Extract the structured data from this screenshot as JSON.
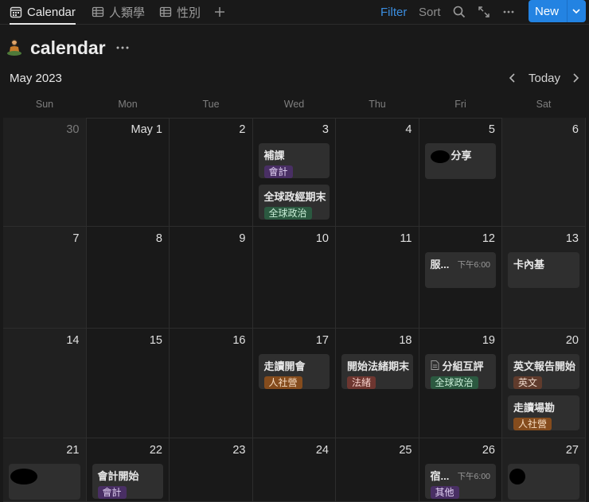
{
  "tabs": [
    {
      "label": "Calendar",
      "icon": "calendar-icon",
      "active": true
    },
    {
      "label": "人類學",
      "icon": "table-icon",
      "active": false
    },
    {
      "label": "性別",
      "icon": "table-icon",
      "active": false
    }
  ],
  "toolbar": {
    "filter_label": "Filter",
    "sort_label": "Sort",
    "new_label": "New",
    "accent": "#2383e2",
    "filter_color": "#3b8ee0"
  },
  "page": {
    "title": "calendar",
    "emoji_icon": "person-meditating-icon"
  },
  "calendar": {
    "month_label": "May 2023",
    "today_label": "Today",
    "weekdays": [
      "Sun",
      "Mon",
      "Tue",
      "Wed",
      "Thu",
      "Fri",
      "Sat"
    ],
    "weeks": [
      [
        {
          "day": "30",
          "muted": true,
          "events": []
        },
        {
          "day": "May 1",
          "events": []
        },
        {
          "day": "2",
          "events": []
        },
        {
          "day": "3",
          "events": [
            {
              "title": "補課",
              "tag": "會計",
              "tag_color": "purple"
            },
            {
              "title": "全球政經期末",
              "tag": "全球政治",
              "tag_color": "green"
            }
          ]
        },
        {
          "day": "4",
          "events": []
        },
        {
          "day": "5",
          "events": [
            {
              "title": "分享",
              "redacted": true
            }
          ]
        },
        {
          "day": "6",
          "events": []
        }
      ],
      [
        {
          "day": "7",
          "events": []
        },
        {
          "day": "8",
          "events": []
        },
        {
          "day": "9",
          "events": []
        },
        {
          "day": "10",
          "events": []
        },
        {
          "day": "11",
          "events": []
        },
        {
          "day": "12",
          "events": [
            {
              "title": "服...",
              "time": "下午6:00"
            }
          ]
        },
        {
          "day": "13",
          "events": [
            {
              "title": "卡內基"
            }
          ]
        }
      ],
      [
        {
          "day": "14",
          "events": []
        },
        {
          "day": "15",
          "events": []
        },
        {
          "day": "16",
          "events": []
        },
        {
          "day": "17",
          "events": [
            {
              "title": "走讀開會",
              "tag": "人社營",
              "tag_color": "orange"
            }
          ]
        },
        {
          "day": "18",
          "events": [
            {
              "title": "開始法緒期末",
              "tag": "法緒",
              "tag_color": "red"
            }
          ]
        },
        {
          "day": "19",
          "events": [
            {
              "title": "分組互評",
              "doc_icon": true,
              "tag": "全球政治",
              "tag_color": "green"
            }
          ]
        },
        {
          "day": "20",
          "events": [
            {
              "title": "英文報告開始",
              "tag": "英文",
              "tag_color": "brown"
            },
            {
              "title": "走讀場勘",
              "tag": "人社營",
              "tag_color": "orange"
            }
          ]
        }
      ],
      [
        {
          "day": "21",
          "events": [
            {
              "title": "",
              "redacted": true
            }
          ]
        },
        {
          "day": "22",
          "events": [
            {
              "title": "會計開始",
              "tag": "會計",
              "tag_color": "purple"
            }
          ]
        },
        {
          "day": "23",
          "events": []
        },
        {
          "day": "24",
          "events": []
        },
        {
          "day": "25",
          "events": []
        },
        {
          "day": "26",
          "events": [
            {
              "title": "宿...",
              "time": "下午6:00",
              "tag": "其他",
              "tag_color": "purple"
            }
          ]
        },
        {
          "day": "27",
          "events": [
            {
              "title": "",
              "redacted": true
            }
          ]
        }
      ]
    ]
  },
  "tag_colors": {
    "purple": {
      "bg": "#492f64",
      "fg": "#e3d3f5"
    },
    "green": {
      "bg": "#2b5940",
      "fg": "#c7ecd5"
    },
    "orange": {
      "bg": "#854c1d",
      "fg": "#f7dcc0"
    },
    "red": {
      "bg": "#6e3630",
      "fg": "#f5cfc9"
    },
    "brown": {
      "bg": "#603b2c",
      "fg": "#ecd6c8"
    }
  }
}
